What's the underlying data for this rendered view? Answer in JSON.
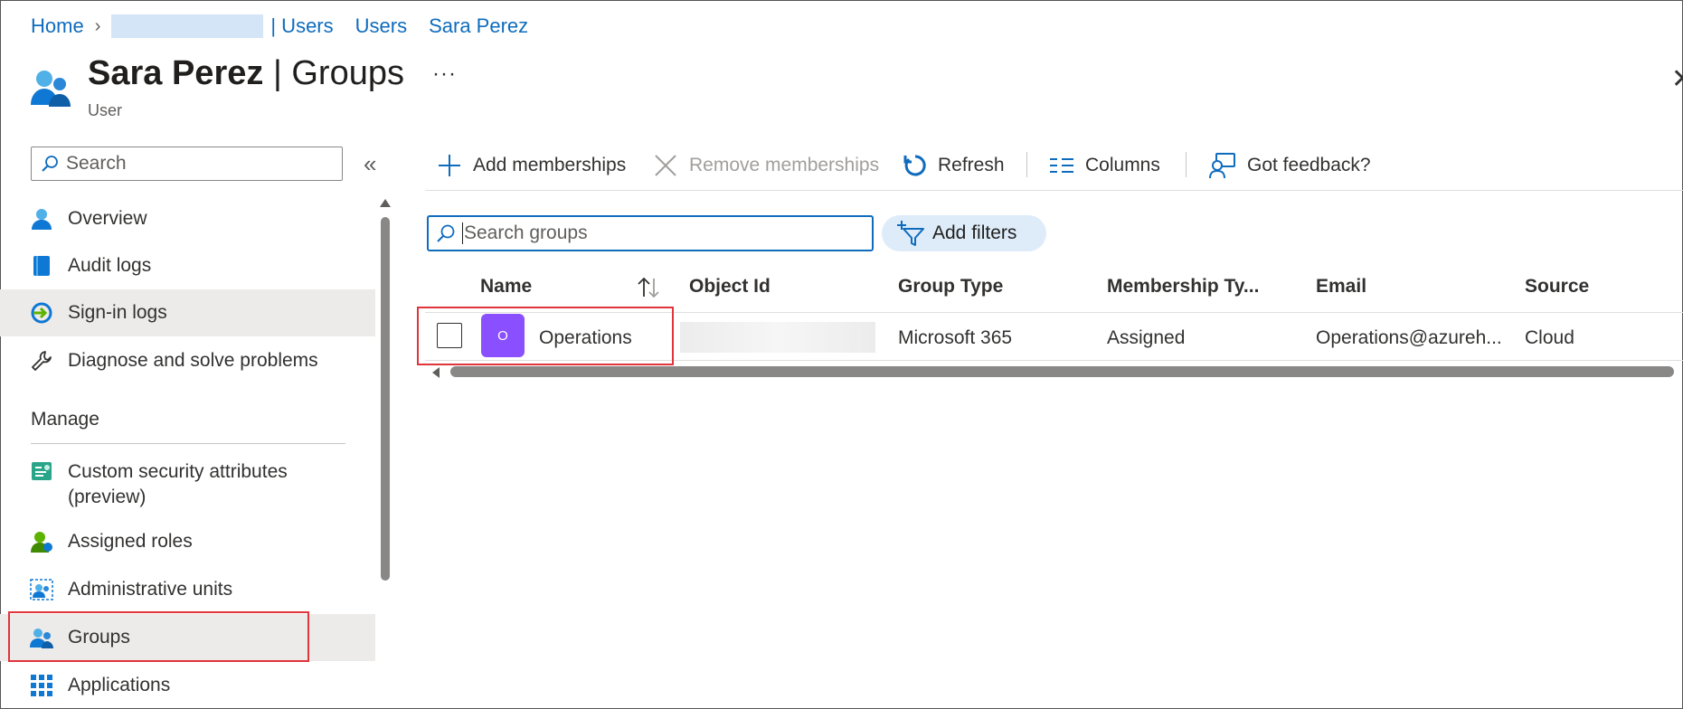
{
  "breadcrumb": {
    "home": "Home",
    "tenant_suffix": "| Users",
    "users": "Users",
    "user": "Sara Perez"
  },
  "header": {
    "title_name": "Sara Perez",
    "title_section": "Groups",
    "subtitle": "User",
    "more": "···",
    "close": "✕"
  },
  "sidebar": {
    "search_placeholder": "Search",
    "collapse": "«",
    "items_top": [
      {
        "label": "Overview",
        "icon": "user-icon"
      },
      {
        "label": "Audit logs",
        "icon": "book-icon"
      },
      {
        "label": "Sign-in logs",
        "icon": "sign-in-icon",
        "selected": true
      },
      {
        "label": "Diagnose and solve problems",
        "icon": "wrench-icon"
      }
    ],
    "section_manage": "Manage",
    "items_manage": [
      {
        "label": "Custom security attributes",
        "label2": "(preview)",
        "icon": "attributes-icon"
      },
      {
        "label": "Assigned roles",
        "icon": "role-icon"
      },
      {
        "label": "Administrative units",
        "icon": "admin-units-icon"
      },
      {
        "label": "Groups",
        "icon": "groups-icon",
        "selected": true
      },
      {
        "label": "Applications",
        "icon": "apps-grid-icon"
      }
    ]
  },
  "toolbar": {
    "add": "Add memberships",
    "remove": "Remove memberships",
    "refresh": "Refresh",
    "columns": "Columns",
    "feedback": "Got feedback?"
  },
  "filters": {
    "search_placeholder": "Search groups",
    "add_filters": "Add filters"
  },
  "table": {
    "columns": [
      "Name",
      "Object Id",
      "Group Type",
      "Membership Ty...",
      "Email",
      "Source"
    ],
    "rows": [
      {
        "avatar": "O",
        "name": "Operations",
        "group_type": "Microsoft 365",
        "membership_type": "Assigned",
        "email": "Operations@azureh...",
        "source": "Cloud"
      }
    ]
  },
  "colors": {
    "accent": "#0f6cbd",
    "highlight": "#e0353b",
    "avatar": "#8a4fff",
    "selected_bg": "#edebe9"
  }
}
